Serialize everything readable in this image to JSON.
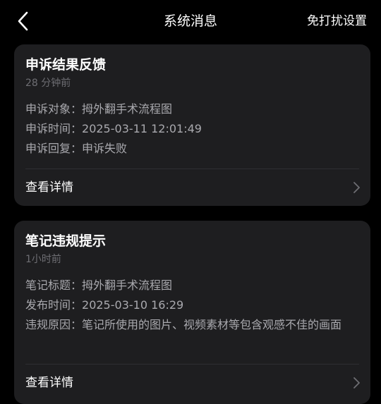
{
  "header": {
    "title": "系统消息",
    "action_label": "免打扰设置"
  },
  "messages": [
    {
      "title": "申诉结果反馈",
      "time": "28 分钟前",
      "fields": [
        {
          "label": "申诉对象：",
          "value": "拇外翻手术流程图"
        },
        {
          "label": "申诉时间：",
          "value": "2025-03-11 12:01:49"
        },
        {
          "label": "申诉回复：",
          "value": "申诉失败"
        }
      ],
      "details_label": "查看详情"
    },
    {
      "title": "笔记违规提示",
      "time": "1小时前",
      "fields": [
        {
          "label": "笔记标题：",
          "value": "拇外翻手术流程图"
        },
        {
          "label": "发布时间：",
          "value": "2025-03-10 16:29"
        },
        {
          "label": "违规原因：",
          "value": "笔记所使用的图片、视频素材等包含观感不佳的画面"
        }
      ],
      "details_label": "查看详情"
    }
  ],
  "icons": {
    "back": "chevron-left-icon",
    "details": "chevron-right-icon"
  },
  "colors": {
    "background": "#000000",
    "card": "#1e1e20",
    "primary_text": "#ffffff",
    "secondary_text": "#a9a9ae",
    "muted_text": "#6e6e73"
  }
}
